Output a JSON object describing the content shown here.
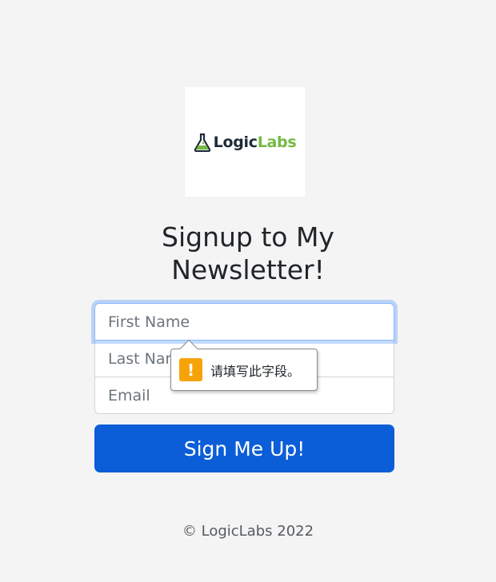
{
  "logo": {
    "text_part1": "Logic",
    "text_part2": "Labs",
    "icon": "flask-icon"
  },
  "title": "Signup to My Newsletter!",
  "form": {
    "first_name_placeholder": "First Name",
    "last_name_placeholder": "Last Name",
    "email_placeholder": "Email",
    "submit_label": "Sign Me Up!"
  },
  "validation_tooltip": {
    "icon": "warning-icon",
    "icon_glyph": "!",
    "message": "请填写此字段。"
  },
  "footer": {
    "text": "© LogicLabs 2022"
  },
  "colors": {
    "background": "#f4f4f4",
    "button": "#0b5ed7",
    "logo_dark": "#1e2a38",
    "logo_green": "#74b943",
    "warning": "#f6a30a"
  }
}
